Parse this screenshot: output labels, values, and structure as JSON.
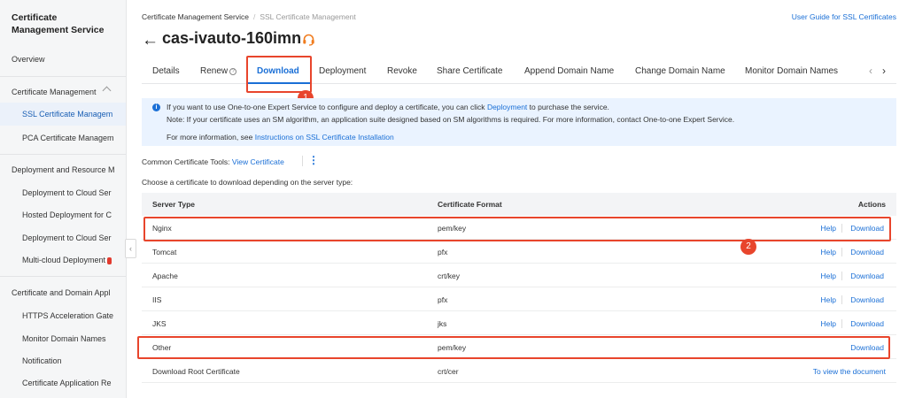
{
  "sidebar": {
    "title_line1": "Certificate",
    "title_line2": "Management Service",
    "overview": "Overview",
    "section1": "Certificate Management",
    "ssl": "SSL Certificate Managem",
    "pca": "PCA Certificate Managem",
    "section2": "Deployment and Resource M",
    "deploy_cloud": "Deployment to Cloud Ser",
    "hosted": "Hosted Deployment for C",
    "deploy_cloud2": "Deployment to Cloud Ser",
    "multicloud": "Multi-cloud Deployment",
    "section3": "Certificate and Domain Appl",
    "https": "HTTPS Acceleration Gate",
    "monitor": "Monitor Domain Names",
    "notification": "Notification",
    "application": "Certificate Application Re",
    "collapse_glyph": "‹"
  },
  "breadcrumb": {
    "root": "Certificate Management Service",
    "sep": "/",
    "current": "SSL Certificate Management"
  },
  "guide_link": "User Guide for SSL Certificates",
  "header": {
    "back_glyph": "←",
    "title": "cas-ivauto-160imn"
  },
  "tabs": {
    "details": "Details",
    "renew": "Renew",
    "renew_help": "?",
    "download": "Download",
    "deployment": "Deployment",
    "revoke": "Revoke",
    "share": "Share Certificate",
    "append": "Append Domain Name",
    "change": "Change Domain Name",
    "monitor": "Monitor Domain Names",
    "prev": "‹",
    "next": "›"
  },
  "annotations": {
    "step1": "1",
    "step2": "2"
  },
  "notice": {
    "icon": "i",
    "line1_pre": "If you want to use One-to-one Expert Service to configure and deploy a certificate, you can click",
    "line1_link": "Deployment",
    "line1_post": "to purchase the service.",
    "line2": "Note: If your certificate uses an SM algorithm, an application suite designed based on SM algorithms is required. For more information, contact One-to-one Expert Service.",
    "line3_pre": "For more information, see",
    "line3_link": "Instructions on SSL Certificate Installation"
  },
  "tools": {
    "label": "Common Certificate Tools:",
    "link": "View Certificate",
    "more": "⋮"
  },
  "choose_text": "Choose a certificate to download depending on the server type:",
  "table": {
    "headers": {
      "server": "Server Type",
      "format": "Certificate Format",
      "actions": "Actions"
    },
    "rows": [
      {
        "server": "Nginx",
        "format": "pem/key",
        "help": "Help",
        "download": "Download"
      },
      {
        "server": "Tomcat",
        "format": "pfx",
        "help": "Help",
        "download": "Download"
      },
      {
        "server": "Apache",
        "format": "crt/key",
        "help": "Help",
        "download": "Download"
      },
      {
        "server": "IIS",
        "format": "pfx",
        "help": "Help",
        "download": "Download"
      },
      {
        "server": "JKS",
        "format": "jks",
        "help": "Help",
        "download": "Download"
      },
      {
        "server": "Other",
        "format": "pem/key",
        "download": "Download"
      },
      {
        "server": "Download Root Certificate",
        "format": "crt/cer",
        "doc": "To view the document"
      }
    ]
  },
  "colors": {
    "accent": "#1a6fd6",
    "highlight": "#e8452c",
    "notice_bg": "#eaf3ff",
    "headset": "#f07c1e"
  },
  "icons": {
    "back": "arrow-left-icon",
    "headset": "headset-icon",
    "info": "info-icon",
    "more": "more-vertical-icon"
  }
}
